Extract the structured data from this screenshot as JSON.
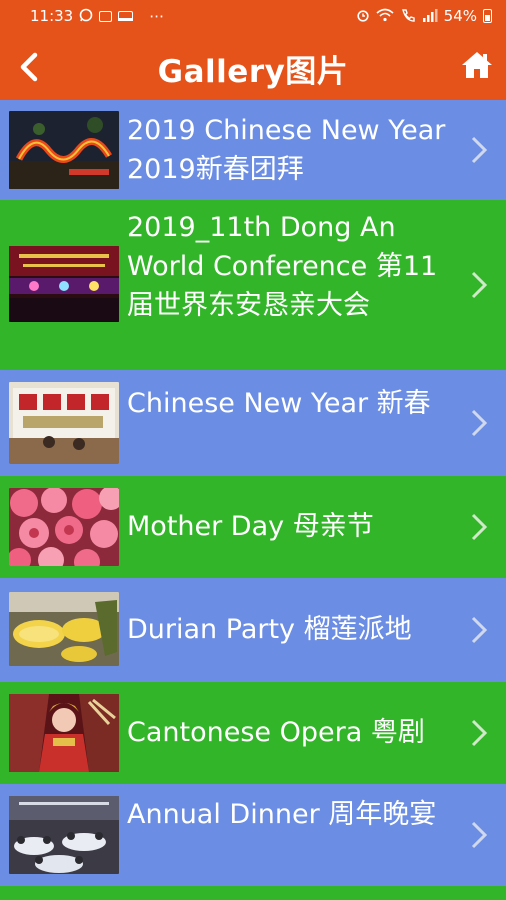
{
  "status_bar": {
    "time": "11:33",
    "dots": "⋯",
    "battery": "54%"
  },
  "app_bar": {
    "title": "Gallery图片",
    "back_icon": "chevron-left-icon",
    "home_icon": "home-icon"
  },
  "gallery": {
    "items": [
      {
        "label": "2019 Chinese New Year  2019新春团拜",
        "thumbnail": "dragon-lantern-photo",
        "color": "#6b8de3"
      },
      {
        "label": "2019_11th Dong An World  Conference 第11届世界东安恳亲大会",
        "thumbnail": "conference-stage-photo",
        "color": "#33b52a"
      },
      {
        "label": "Chinese New Year 新春",
        "thumbnail": "new-year-event-photo",
        "color": "#6b8de3"
      },
      {
        "label": "Mother Day 母亲节",
        "thumbnail": "pink-roses-photo",
        "color": "#33b52a"
      },
      {
        "label": "Durian Party 榴莲派地",
        "thumbnail": "durian-photo",
        "color": "#6b8de3"
      },
      {
        "label": "Cantonese Opera 粤剧",
        "thumbnail": "opera-performer-photo",
        "color": "#33b52a"
      },
      {
        "label": "Annual Dinner 周年晚宴",
        "thumbnail": "dinner-hall-photo",
        "color": "#6b8de3"
      }
    ]
  },
  "colors": {
    "accent": "#e5531a",
    "row_blue": "#6b8de3",
    "row_green": "#33b52a"
  }
}
